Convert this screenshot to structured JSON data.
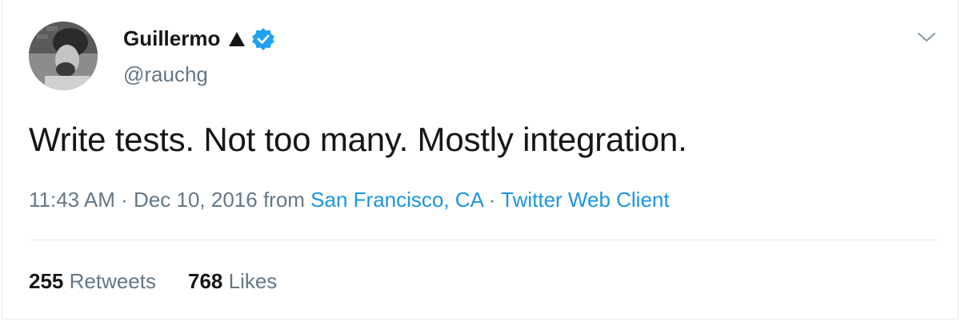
{
  "tweet": {
    "author": {
      "name": "Guillermo",
      "handle": "@rauchg"
    },
    "text": "Write tests. Not too many. Mostly integration.",
    "meta": {
      "time": "11:43 AM",
      "separator1": " · ",
      "date": "Dec 10, 2016",
      "from_label": " from ",
      "location": "San Francisco, CA",
      "separator2": " · ",
      "client": "Twitter Web Client"
    },
    "stats": {
      "retweets_count": "255",
      "retweets_label": " Retweets",
      "likes_count": "768",
      "likes_label": " Likes"
    }
  },
  "icons": {
    "name_badge": "triangle-icon",
    "verified": "verified-badge-icon",
    "menu": "chevron-down-icon"
  },
  "colors": {
    "text": "#14171a",
    "secondary": "#657786",
    "link": "#1b95e0",
    "verified": "#1da1f2",
    "divider": "#e6ecf0"
  }
}
